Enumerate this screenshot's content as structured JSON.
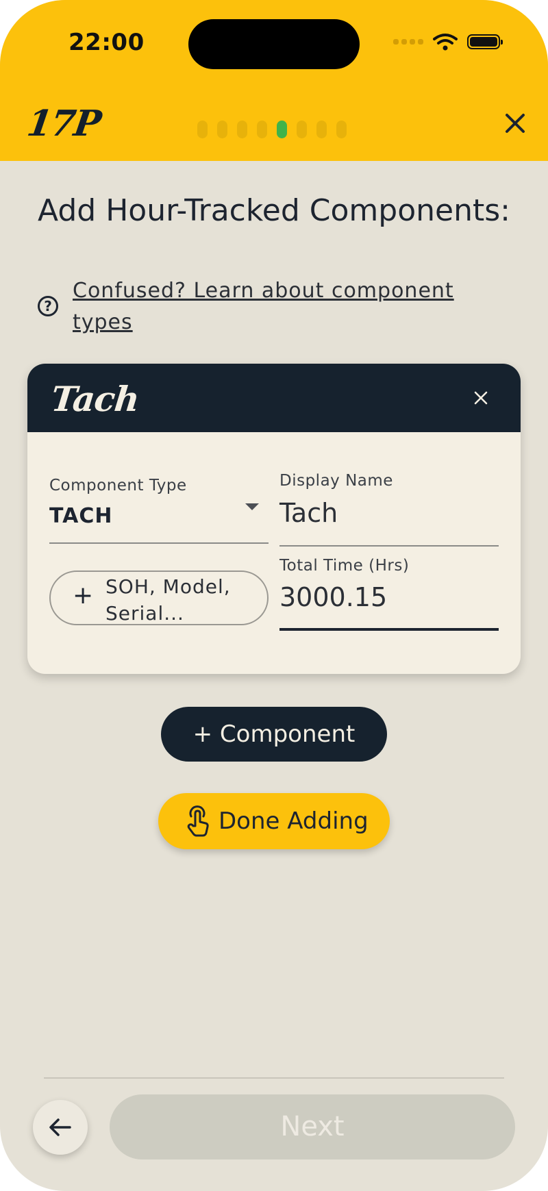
{
  "status_bar": {
    "time": "22:00"
  },
  "header": {
    "logo_text": "17P",
    "progress": {
      "total_steps": 8,
      "current_step": 5
    }
  },
  "page": {
    "title": "Add Hour-Tracked Components:",
    "help_link": "Confused? Learn about component types"
  },
  "component_card": {
    "title": "Tach",
    "component_type": {
      "label": "Component Type",
      "value": "TACH"
    },
    "display_name": {
      "label": "Display Name",
      "value": "Tach"
    },
    "total_time": {
      "label": "Total Time (Hrs)",
      "value": "3000.15"
    },
    "details_button": {
      "plus": "+",
      "label": "SOH, Model, Serial..."
    }
  },
  "actions": {
    "add_component": "+ Component",
    "done_adding": "Done Adding"
  },
  "footer": {
    "next_label": "Next"
  },
  "colors": {
    "accent_yellow": "#fcc10c",
    "navy": "#16222e",
    "background": "#e5e1d6",
    "card": "#f4efe3",
    "progress_active": "#40b34a"
  }
}
